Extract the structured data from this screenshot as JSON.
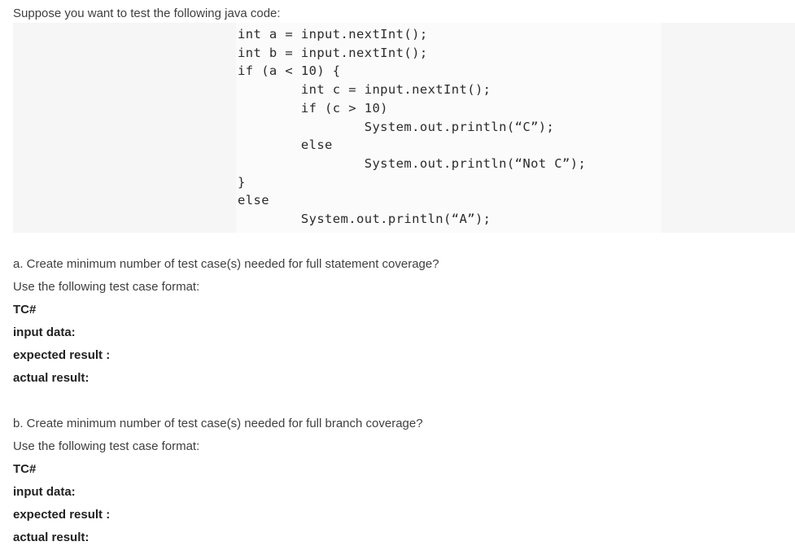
{
  "intro": {
    "text": "Suppose you want to test the following java code:"
  },
  "code_block": {
    "language": "java",
    "lines": [
      "int a = input.nextInt();",
      "int b = input.nextInt();",
      "if (a < 10) {",
      "        int c = input.nextInt();",
      "        if (c > 10)",
      "                System.out.println(“C”);",
      "        else",
      "                System.out.println(“Not C”);",
      "}",
      "else",
      "        System.out.println(“A”);"
    ],
    "background_color": "#f6f6f6"
  },
  "sections": [
    {
      "id": "a",
      "prompt": "a. Create minimum number of test case(s) needed for full statement coverage?",
      "format_intro": "Use the following test case format:",
      "fields": [
        "TC#",
        "input data:",
        "expected result :",
        "actual result:"
      ]
    },
    {
      "id": "b",
      "prompt": "b. Create minimum number of test case(s) needed for full branch coverage?",
      "format_intro": "Use the following test case format:",
      "fields": [
        "TC#",
        "input data:",
        "expected result :",
        "actual result:"
      ]
    }
  ]
}
